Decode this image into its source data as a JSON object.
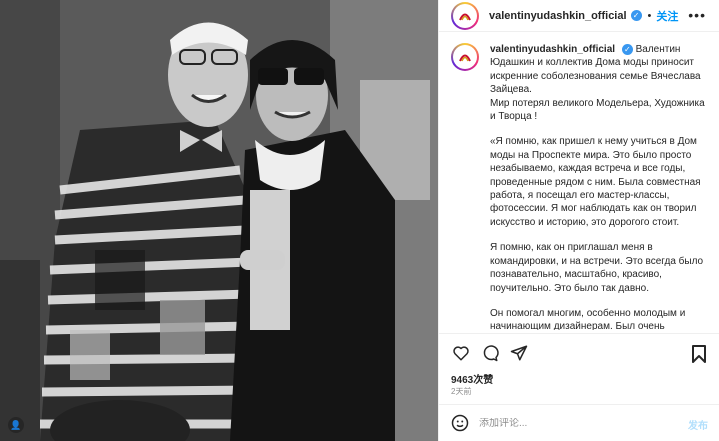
{
  "photo": {
    "alt": "Black and white photo of two men"
  },
  "header": {
    "username": "valentinyudashkin_official",
    "verified_icon": "verified-badge-icon",
    "separator": "•",
    "follow_label": "关注",
    "more_label": "•••"
  },
  "caption": {
    "username": "valentinyudashkin_official",
    "paragraphs": [
      "Валентин Юдашкин и коллектив Дома моды приносит искренние соболезнования семье Вячеслава Зайцева.\nМир потерял великого Модельера, Художника и Творца !",
      "«Я помню, как пришел к нему учиться в Дом моды на Проспекте мира. Это было просто незабываемо, каждая встреча и все годы, проведенные рядом с ним. Была совместная работа, я посещал его мастер-классы, фотосессии. Я мог наблюдать как он творил искусство и историю, это дорогого стоит.",
      "Я помню, как он приглашал меня в командировки, и на встречи. Это всегда было познавательно, масштабно, красиво, поучительно. Это было так давно.",
      "Он помогал многим, особенно молодым и начинающим дизайнерам. Был очень открытым. И большим профессионалом."
    ]
  },
  "actions": {
    "like_icon": "heart-icon",
    "comment_icon": "comment-icon",
    "share_icon": "send-icon",
    "save_icon": "bookmark-icon"
  },
  "stats": {
    "views": "9463次赞",
    "date": "2天前"
  },
  "comment": {
    "placeholder": "添加评论...",
    "post_label": "发布",
    "emoji_icon": "smiley-icon"
  },
  "colors": {
    "accent": "#0095f6",
    "verified": "#3897f0",
    "muted": "#8e8e8e"
  }
}
